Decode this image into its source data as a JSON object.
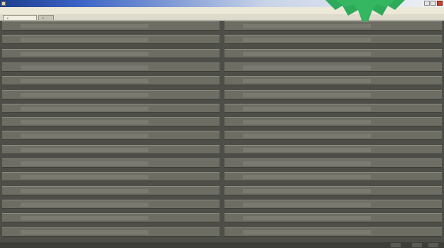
{
  "window": {
    "title": ""
  },
  "menubar": {
    "items": [
      ""
    ]
  },
  "tabs": [
    {
      "label": "",
      "active": true
    },
    {
      "label": "",
      "active": false
    }
  ],
  "left_column": {
    "rows": [
      {
        "label": "",
        "link1": "",
        "link2": "",
        "link3": ""
      },
      {
        "label": "",
        "link1": "",
        "link2": "",
        "link3": ""
      },
      {
        "label": "",
        "link1": "",
        "link2": "",
        "link3": ""
      },
      {
        "label": "",
        "link1": "",
        "link2": "",
        "link3": ""
      },
      {
        "label": "",
        "link1": "",
        "link2": "",
        "link3": ""
      },
      {
        "label": "",
        "link1": "",
        "link2": "",
        "link3": ""
      },
      {
        "label": "",
        "link1": "",
        "link2": "",
        "link3": ""
      },
      {
        "label": "",
        "link1": "",
        "link2": "",
        "link3": ""
      },
      {
        "label": "",
        "link1": "",
        "link2": "",
        "link3": ""
      },
      {
        "label": "",
        "link1": "",
        "link2": "",
        "link3": ""
      },
      {
        "label": "",
        "link1": "",
        "link2": "",
        "link3": ""
      },
      {
        "label": "",
        "link1": "",
        "link2": "",
        "link3": ""
      },
      {
        "label": "",
        "link1": "",
        "link2": "",
        "link3": ""
      },
      {
        "label": "",
        "link1": "",
        "link2": "",
        "link3": ""
      },
      {
        "label": "",
        "link1": "",
        "link2": "",
        "link3": ""
      },
      {
        "label": "",
        "link1": "",
        "link2": "",
        "link3": ""
      }
    ]
  },
  "right_column": {
    "rows": [
      {
        "label": "",
        "link1": "",
        "link2": "",
        "link3": ""
      },
      {
        "label": "",
        "link1": "",
        "link2": "",
        "link3": ""
      },
      {
        "label": "",
        "link1": "",
        "link2": "",
        "link3": ""
      },
      {
        "label": "",
        "link1": "",
        "link2": "",
        "link3": ""
      },
      {
        "label": "",
        "link1": "",
        "link2": "",
        "link3": ""
      },
      {
        "label": "",
        "link1": "",
        "link2": "",
        "link3": ""
      },
      {
        "label": "",
        "link1": "",
        "link2": "",
        "link3": ""
      },
      {
        "label": "",
        "link1": "",
        "link2": "",
        "link3": ""
      },
      {
        "label": "",
        "link1": "",
        "link2": "",
        "link3": ""
      },
      {
        "label": "",
        "link1": "",
        "link2": "",
        "link3": ""
      },
      {
        "label": "",
        "link1": "",
        "link2": "",
        "link3": ""
      },
      {
        "label": "",
        "link1": "",
        "link2": "",
        "link3": ""
      },
      {
        "label": "",
        "link1": "",
        "link2": "",
        "link3": ""
      },
      {
        "label": "",
        "link1": "",
        "link2": "",
        "link3": ""
      },
      {
        "label": "",
        "link1": "",
        "link2": "",
        "link3": ""
      },
      {
        "label": "",
        "link1": "",
        "link2": "",
        "link3": ""
      }
    ]
  },
  "statusbar": {
    "text": ""
  },
  "icons": {
    "app": "app-icon",
    "badge": "star-badge-icon",
    "tab_close": "close-icon"
  },
  "colors": {
    "titlebar": "#1d3d8c",
    "badge": "#2faa5a",
    "grid_background": "#4e4e48",
    "row": "#6d6d63",
    "link": "#7f9ed0"
  }
}
